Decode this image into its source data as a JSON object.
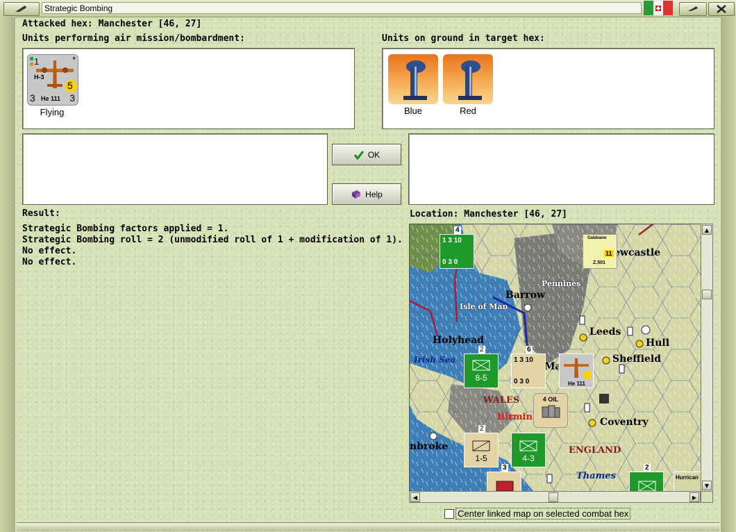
{
  "window": {
    "title": "Strategic Bombing"
  },
  "attacked": "Attacked hex: Manchester  [46, 27]",
  "air_panel": {
    "label": "Units performing air mission/bombardment:",
    "unit": {
      "caption": "Flying",
      "top_left": "1",
      "type": "H-3",
      "name": "He 111",
      "attack": "3",
      "defense": "3",
      "range": "5",
      "star": "*"
    }
  },
  "ground_panel": {
    "label": "Units on ground in target hex:",
    "units": [
      {
        "caption": "Blue"
      },
      {
        "caption": "Red"
      }
    ]
  },
  "buttons": {
    "ok": "OK",
    "help": "Help"
  },
  "result": {
    "label": "Result:",
    "lines": [
      "Strategic Bombing factors applied = 1.",
      "Strategic Bombing roll = 2 (unmodified roll of 1 + modification of 1).",
      "No effect.",
      "No effect."
    ]
  },
  "location": "Location:  Manchester  [46, 27]",
  "map": {
    "labels": {
      "newcastle": "ewcastle",
      "pennines": "Pennines",
      "barrow": "Barrow",
      "isle_of_man": "Isle of Man",
      "leeds": "Leeds",
      "hull": "Hull",
      "holyhead": "Holyhead",
      "irish_sea": "Irish Sea",
      "sheffield": "Sheffield",
      "wales": "WALES",
      "birmingham": "Birmin",
      "coventry": "Coventry",
      "pembroke": "nbroke",
      "england": "ENGLAND",
      "thames": "Thames",
      "oil": "4 OIL",
      "manchester": "Ma"
    },
    "counters": {
      "fleet_top": "4",
      "fleet_top_vals": "1 3 10",
      "fleet_top_bot": "0 3 0",
      "air_ne": "Gabbiano",
      "air_ne_vals": "11",
      "air_ne_id": "Z.501",
      "inf_xxx": "8-5",
      "inf_stack": "2",
      "naval_mid": "6",
      "naval_vals": "1 3 10",
      "naval_bot": "0 3 0",
      "bomber_map": "He 111",
      "inf_xx": "1-5",
      "inf_green": "4-3",
      "stack2": "2",
      "stack3": "3",
      "stack_se": "2",
      "hurricane": "Hurrican"
    }
  },
  "checkbox": {
    "label": "Center linked map on selected combat hex",
    "checked": false
  },
  "colors": {
    "panel_bg": "#d7e1b6",
    "sea": "#3e7fb8",
    "land": "#d6d7a9",
    "hills": "#7c7c76",
    "green_counter": "#1e9a2a",
    "tan_counter": "#e4d3a4"
  }
}
